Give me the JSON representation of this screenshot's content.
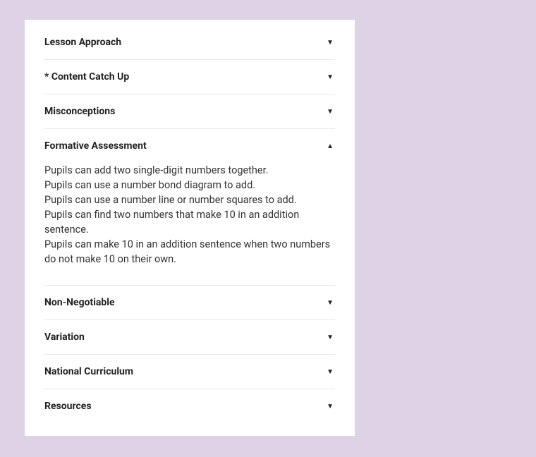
{
  "sections": [
    {
      "title": "Lesson Approach",
      "expanded": false,
      "content": []
    },
    {
      "title": "* Content Catch Up",
      "expanded": false,
      "content": []
    },
    {
      "title": "Misconceptions",
      "expanded": false,
      "content": []
    },
    {
      "title": "Formative Assessment",
      "expanded": true,
      "content": [
        "Pupils can add two single-digit numbers together.",
        "Pupils can use a number bond diagram to add.",
        "Pupils can use a number line or number squares to add.",
        "Pupils can find two numbers that make 10 in an addition sentence.",
        "Pupils can make 10 in an addition sentence when two numbers do not make 10 on their own."
      ]
    },
    {
      "title": "Non-Negotiable",
      "expanded": false,
      "content": []
    },
    {
      "title": "Variation",
      "expanded": false,
      "content": []
    },
    {
      "title": "National Curriculum",
      "expanded": false,
      "content": []
    },
    {
      "title": "Resources",
      "expanded": false,
      "content": []
    }
  ]
}
